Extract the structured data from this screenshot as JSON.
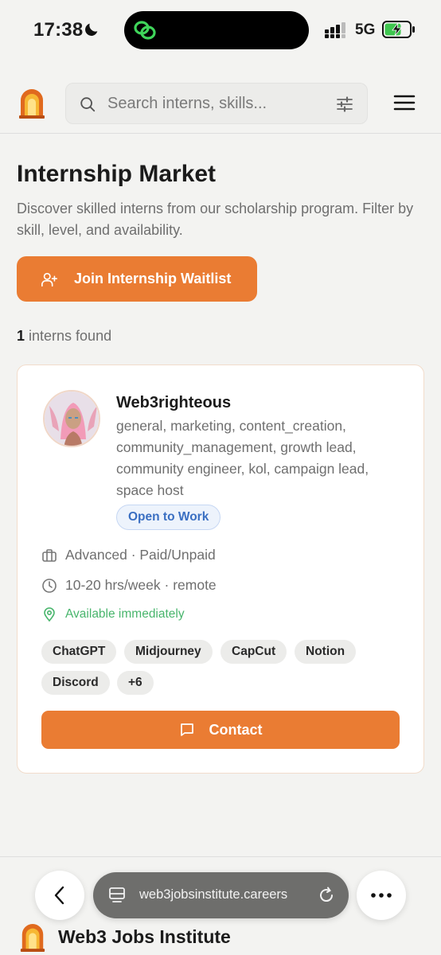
{
  "status_bar": {
    "time": "17:38",
    "network": "5G"
  },
  "header": {
    "search": {
      "placeholder": "Search interns, skills..."
    }
  },
  "main": {
    "title": "Internship Market",
    "description": "Discover skilled interns from our scholarship program. Filter by skill, level, and availability.",
    "waitlist_button": "Join Internship Waitlist",
    "count_number": "1",
    "count_text": " interns found"
  },
  "card": {
    "name": "Web3righteous",
    "skills": "general, marketing, content_creation, community_management, growth lead, community engineer, kol, campaign lead, space host",
    "status_badge": "Open to Work",
    "level": "Advanced · Paid/Unpaid",
    "hours": "10-20 hrs/week · remote",
    "availability": "Available immediately",
    "tags": [
      "ChatGPT",
      "Midjourney",
      "CapCut",
      "Notion",
      "Discord",
      "+6"
    ],
    "contact_button": "Contact"
  },
  "browser": {
    "url": "web3jobsinstitute.careers"
  },
  "footer": {
    "title": "Web3 Jobs Institute"
  },
  "colors": {
    "accent": "#ea7c33",
    "badge_blue": "#3a6fc2",
    "available_green": "#48b56c"
  }
}
